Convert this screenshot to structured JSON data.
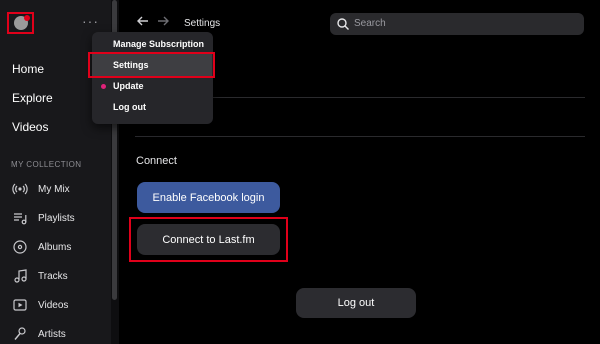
{
  "sidebar": {
    "more_label": "···",
    "nav": [
      {
        "label": "Home"
      },
      {
        "label": "Explore"
      },
      {
        "label": "Videos"
      }
    ],
    "section_title": "MY COLLECTION",
    "collection": [
      {
        "label": "My Mix",
        "icon": "radio-icon"
      },
      {
        "label": "Playlists",
        "icon": "playlist-icon"
      },
      {
        "label": "Albums",
        "icon": "album-icon"
      },
      {
        "label": "Tracks",
        "icon": "music-note-icon"
      },
      {
        "label": "Videos",
        "icon": "video-icon"
      },
      {
        "label": "Artists",
        "icon": "microphone-icon"
      }
    ]
  },
  "dropdown": {
    "items": [
      {
        "label": "Manage Subscription"
      },
      {
        "label": "Settings"
      },
      {
        "label": "Update"
      },
      {
        "label": "Log out"
      }
    ]
  },
  "topbar": {
    "title": "Settings",
    "search_placeholder": "Search"
  },
  "main": {
    "connect_title": "Connect",
    "facebook_label": "Enable Facebook login",
    "lastfm_label": "Connect to Last.fm",
    "logout_label": "Log out"
  },
  "colors": {
    "facebook_button": "#3d5a9e",
    "highlight_border": "#e0001a",
    "update_dot": "#e0227a"
  }
}
